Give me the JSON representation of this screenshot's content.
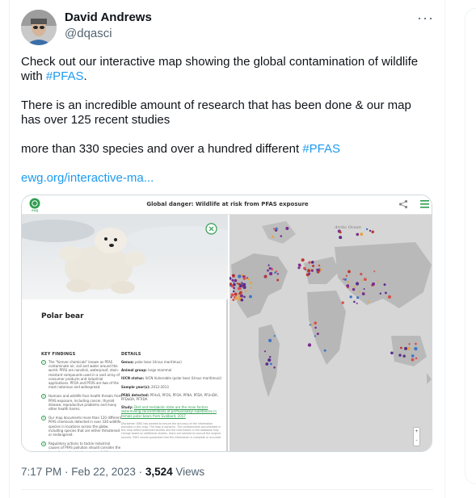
{
  "author": {
    "name": "David Andrews",
    "handle": "@dqasci"
  },
  "tweet": {
    "line1_prefix": "Check out our interactive map showing the global contamination of wildlife with ",
    "line1_hashtag": "#PFAS",
    "line1_suffix": ".",
    "para2": "There is an incredible amount of research that has been done & our map has over 125 recent studies",
    "para3_prefix": "more than 330 species and over a hundred different ",
    "para3_hashtag": "#PFAS",
    "link": "ewg.org/interactive-ma..."
  },
  "card": {
    "title": "Global danger: Wildlife at risk from PFAS exposure",
    "logo_text": "ewg",
    "species": "Polar bear",
    "key_findings_label": "KEY FINDINGS",
    "details_label": "DETAILS",
    "findings": [
      {
        "num": "1",
        "text": "The \"forever chemicals\" known as PFAS contaminate air, soil and water around the world. PFAS are nonstick, waterproof, stain-resistant compounds used in a vast array of consumer products and industrial applications. PFOA and PFOS are two of the most notorious and widespread."
      },
      {
        "num": "2",
        "text": "Humans and wildlife face health threats from PFAS exposure, including cancer, thyroid disease, reproductive problems and many other health harms."
      },
      {
        "num": "3",
        "text": "Our map documents more than 120 different PFAS chemicals detected in over 330 wildlife species in locations across the globe, including species that are either threatened or endangered."
      },
      {
        "num": "4",
        "text": "Regulatory actions to tackle industrial causes of PFAS pollution should consider the harm these chemicals pose to wildlife."
      }
    ],
    "details": [
      {
        "label": "Genus:",
        "value": "polar bear (Ursus maritimus)"
      },
      {
        "label": "Animal group:",
        "value": "large mammal"
      },
      {
        "label": "IUCN status:",
        "value": "IUCN Vulnerable (polar bear (Ursus maritimus))"
      },
      {
        "label": "Sample year(s):",
        "value": "2012-2013"
      },
      {
        "label": "PFAS detected:",
        "value": "PFHxS, PFOS, PFOA, PFNA, PFDA, PFUnDA, PFDoDA, PFTrDA"
      },
      {
        "label": "Study:",
        "value": "Diet and metabolic state are the main factors determining concentrations of perfluoroalkyl substances in female polar bears from Svalbard, 2017"
      }
    ],
    "disclaimer": "Disclaimer: EWG has worked to ensure the accuracy of the information provided in this map. The map is dynamic. The contaminants documented in this map reflect published studies and the information in the database may change based on additional studies. Users are advised to consult the original sources. EWG cannot guarantee that the information is complete or accurate.",
    "map_label": "Arctic Ocean",
    "zoom_in": "+",
    "zoom_out": "-"
  },
  "meta": {
    "time": "7:17 PM · Feb 22, 2023 · ",
    "views": "3,524",
    "views_label": " Views"
  },
  "colors": {
    "link": "#1d9bf0",
    "text": "#0f1419",
    "muted": "#536471",
    "ewg_green": "#2e9d50"
  }
}
